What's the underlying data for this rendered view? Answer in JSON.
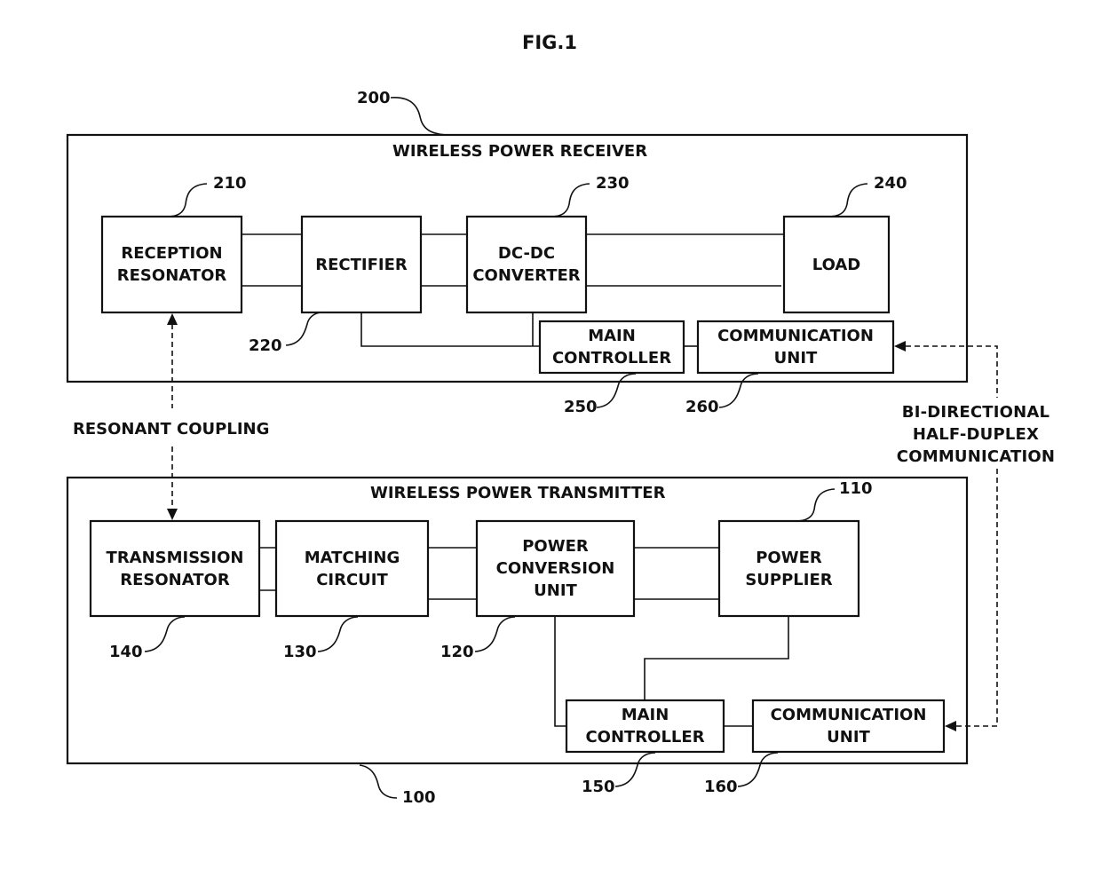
{
  "figure": {
    "title": "FIG.1"
  },
  "receiver": {
    "title": "WIRELESS POWER RECEIVER",
    "ref": "200",
    "blocks": [
      {
        "id": "reception-resonator",
        "lines": [
          "RECEPTION",
          "RESONATOR"
        ],
        "ref": "210"
      },
      {
        "id": "rectifier",
        "lines": [
          "RECTIFIER"
        ],
        "ref": "220"
      },
      {
        "id": "dc-dc-converter",
        "lines": [
          "DC-DC",
          "CONVERTER"
        ],
        "ref": "230"
      },
      {
        "id": "load",
        "lines": [
          "LOAD"
        ],
        "ref": "240"
      },
      {
        "id": "main-controller",
        "lines": [
          "MAIN",
          "CONTROLLER"
        ],
        "ref": "250"
      },
      {
        "id": "communication-unit",
        "lines": [
          "COMMUNICATION",
          "UNIT"
        ],
        "ref": "260"
      }
    ]
  },
  "transmitter": {
    "title": "WIRELESS POWER TRANSMITTER",
    "ref": "100",
    "blocks": [
      {
        "id": "power-supplier",
        "lines": [
          "POWER",
          "SUPPLIER"
        ],
        "ref": "110"
      },
      {
        "id": "power-conversion-unit",
        "lines": [
          "POWER",
          "CONVERSION",
          "UNIT"
        ],
        "ref": "120"
      },
      {
        "id": "matching-circuit",
        "lines": [
          "MATCHING",
          "CIRCUIT"
        ],
        "ref": "130"
      },
      {
        "id": "transmission-resonator",
        "lines": [
          "TRANSMISSION",
          "RESONATOR"
        ],
        "ref": "140"
      },
      {
        "id": "main-controller",
        "lines": [
          "MAIN",
          "CONTROLLER"
        ],
        "ref": "150"
      },
      {
        "id": "communication-unit",
        "lines": [
          "COMMUNICATION",
          "UNIT"
        ],
        "ref": "160"
      }
    ]
  },
  "links": {
    "resonant_coupling": "RESONANT COUPLING",
    "communication": [
      "BI-DIRECTIONAL",
      "HALF-DUPLEX",
      "COMMUNICATION"
    ]
  }
}
